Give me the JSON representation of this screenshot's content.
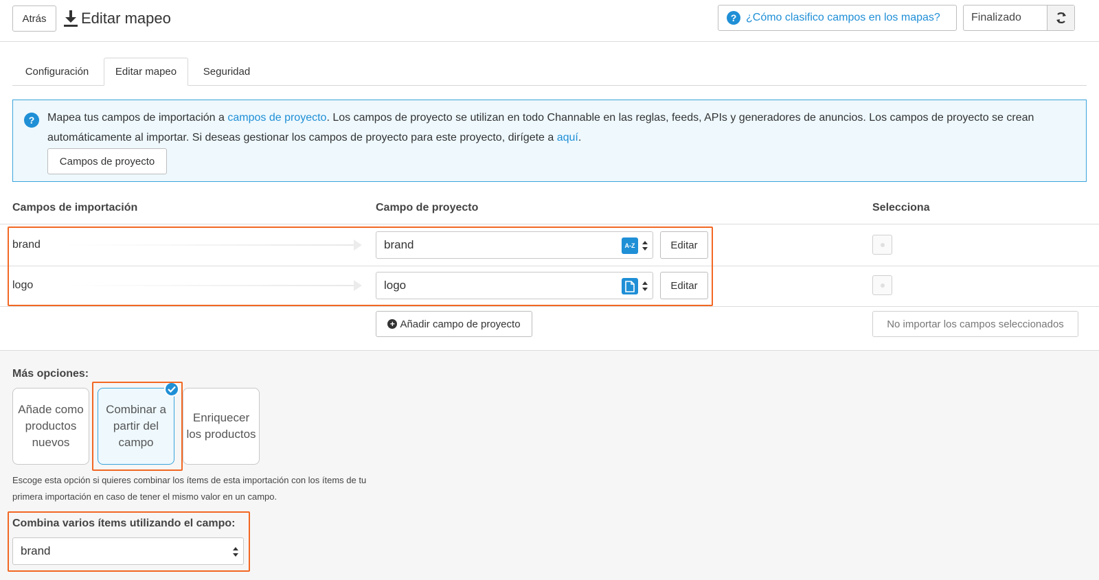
{
  "header": {
    "back_label": "Atrás",
    "title": "Editar mapeo",
    "help_link": "¿Cómo clasifico campos en los mapas?",
    "status": "Finalizado"
  },
  "tabs": [
    {
      "label": "Configuración",
      "active": false
    },
    {
      "label": "Editar mapeo",
      "active": true
    },
    {
      "label": "Seguridad",
      "active": false
    }
  ],
  "info": {
    "text_1": "Mapea tus campos de importación a ",
    "link_1": "campos de proyecto",
    "text_2": ". Los campos de proyecto se utilizan en todo Channable en las reglas, feeds, APIs y generadores de anuncios. Los campos de proyecto se crean automáticamente al importar. Si deseas gestionar los campos de proyecto para este proyecto, dirígete a ",
    "link_2": "aquí",
    "text_3": ".",
    "button": "Campos de proyecto"
  },
  "table": {
    "headers": [
      "Campos de importación",
      "Campo de proyecto",
      "Selecciona"
    ],
    "rows": [
      {
        "import_field": "brand",
        "project_field": "brand",
        "type_icon": "text-az-icon",
        "edit_label": "Editar"
      },
      {
        "import_field": "logo",
        "project_field": "logo",
        "type_icon": "file-icon",
        "edit_label": "Editar"
      }
    ],
    "add_button": "Añadir campo de proyecto",
    "no_import_button": "No importar los campos seleccionados"
  },
  "options": {
    "heading": "Más opciones:",
    "cards": [
      {
        "label": "Añade como productos nuevos",
        "selected": false
      },
      {
        "label": "Combinar a partir del campo",
        "selected": true
      },
      {
        "label": "Enriquecer los productos",
        "selected": false
      }
    ],
    "description": "Escoge esta opción si quieres combinar los ítems de esta importación con los ítems de tu primera importación en caso de tener el mismo valor en un campo.",
    "combine_label": "Combina varios ítems utilizando el campo:",
    "combine_value": "brand"
  },
  "colors": {
    "accent": "#1f8fd6",
    "highlight": "#f26722",
    "info_bg": "#eef8fd"
  }
}
